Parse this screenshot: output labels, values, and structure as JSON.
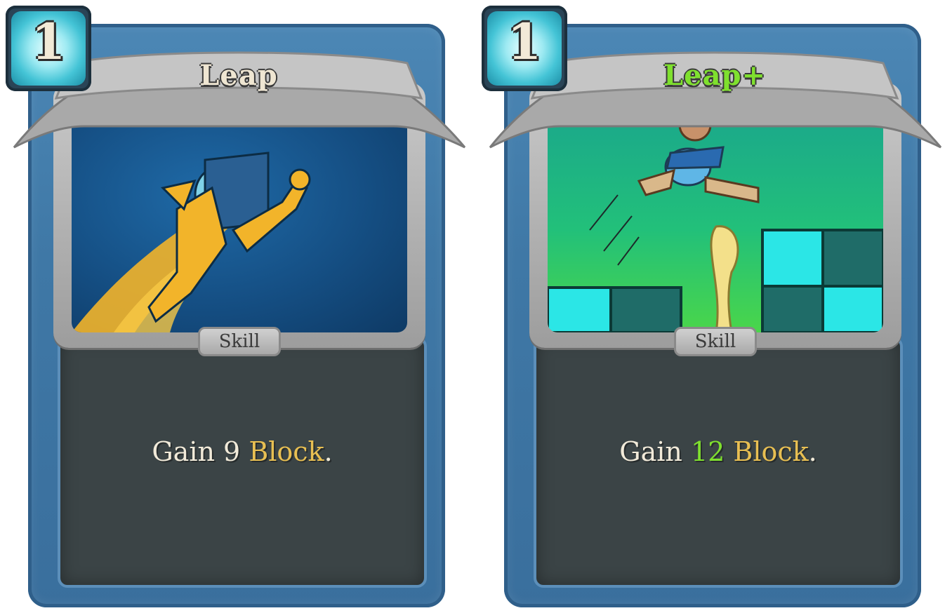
{
  "cards": [
    {
      "cost": "1",
      "name": "Leap",
      "type": "Skill",
      "desc_prefix": "Gain ",
      "desc_value": "9",
      "desc_keyword": "Block",
      "desc_suffix": ".",
      "upgraded": false
    },
    {
      "cost": "1",
      "name": "Leap+",
      "type": "Skill",
      "desc_prefix": "Gain ",
      "desc_value": "12",
      "desc_keyword": "Block",
      "desc_suffix": ".",
      "upgraded": true
    }
  ],
  "colors": {
    "frame_blue": "#4c87b5",
    "keyword_gold": "#e8bf52",
    "upgrade_green": "#7fe02e",
    "text_cream": "#f1ead9"
  }
}
